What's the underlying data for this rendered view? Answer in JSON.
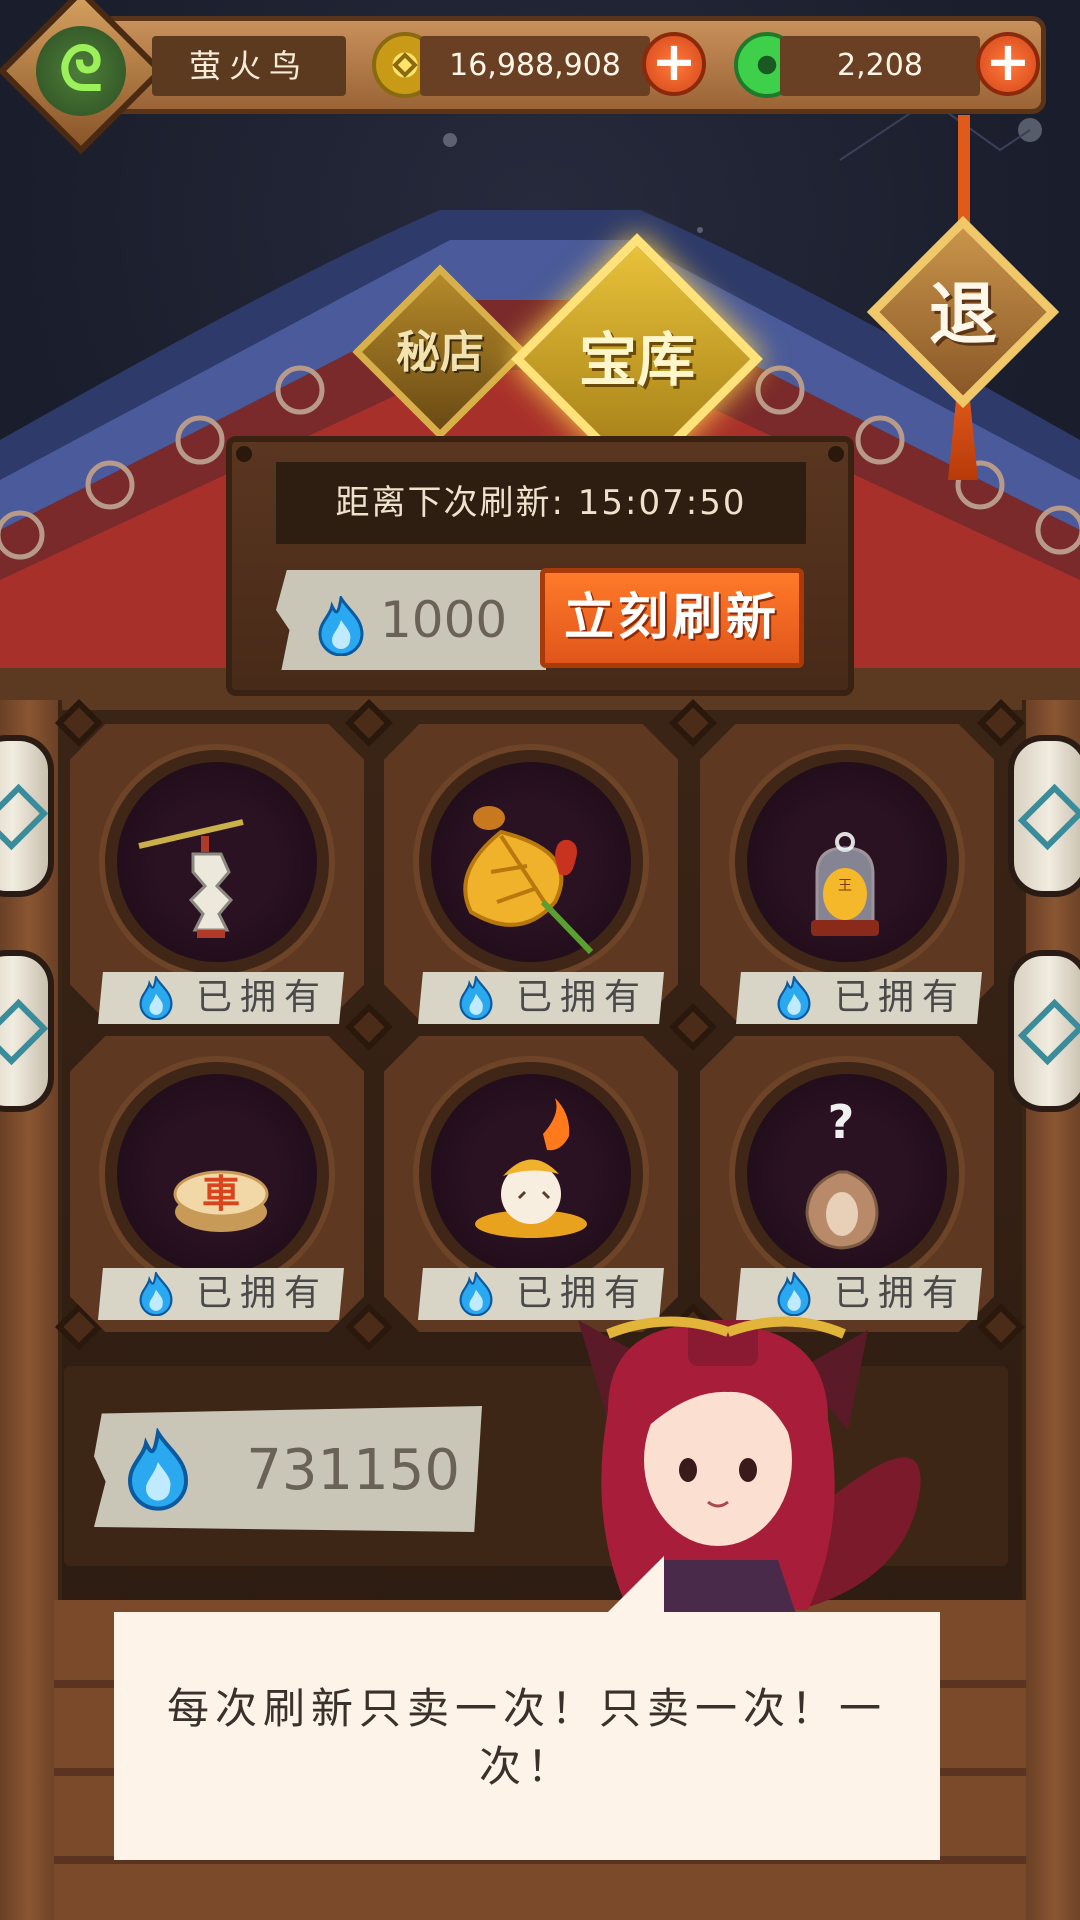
{
  "player": {
    "name": "萤火鸟"
  },
  "currency": {
    "gold": "16,988,908",
    "jade": "2,208",
    "plus_label": "+"
  },
  "tabs": {
    "secret_shop": "秘店",
    "vault": "宝库"
  },
  "exit_label": "退",
  "refresh": {
    "timer_label": "距离下次刷新: 15:07:50",
    "cost": "1000",
    "button_label": "立刻刷新"
  },
  "shop_items": [
    {
      "item": "paper-lantern",
      "status": "已拥有"
    },
    {
      "item": "golden-leaf-fan",
      "status": "已拥有"
    },
    {
      "item": "tiger-in-glass-dome",
      "status": "已拥有"
    },
    {
      "item": "chess-piece-chariot",
      "status": "已拥有",
      "glyph": "車"
    },
    {
      "item": "flame-leaf-spirit",
      "status": "已拥有"
    },
    {
      "item": "mystery-seed",
      "status": "已拥有",
      "glyph": "?"
    }
  ],
  "balance": "731150",
  "npc_speech": "每次刷新只卖一次！只卖一次！一次！",
  "colors": {
    "accent_orange": "#e0561a",
    "gold_tab": "#e8c23a",
    "spirit_flame": "#2aa8f0"
  }
}
